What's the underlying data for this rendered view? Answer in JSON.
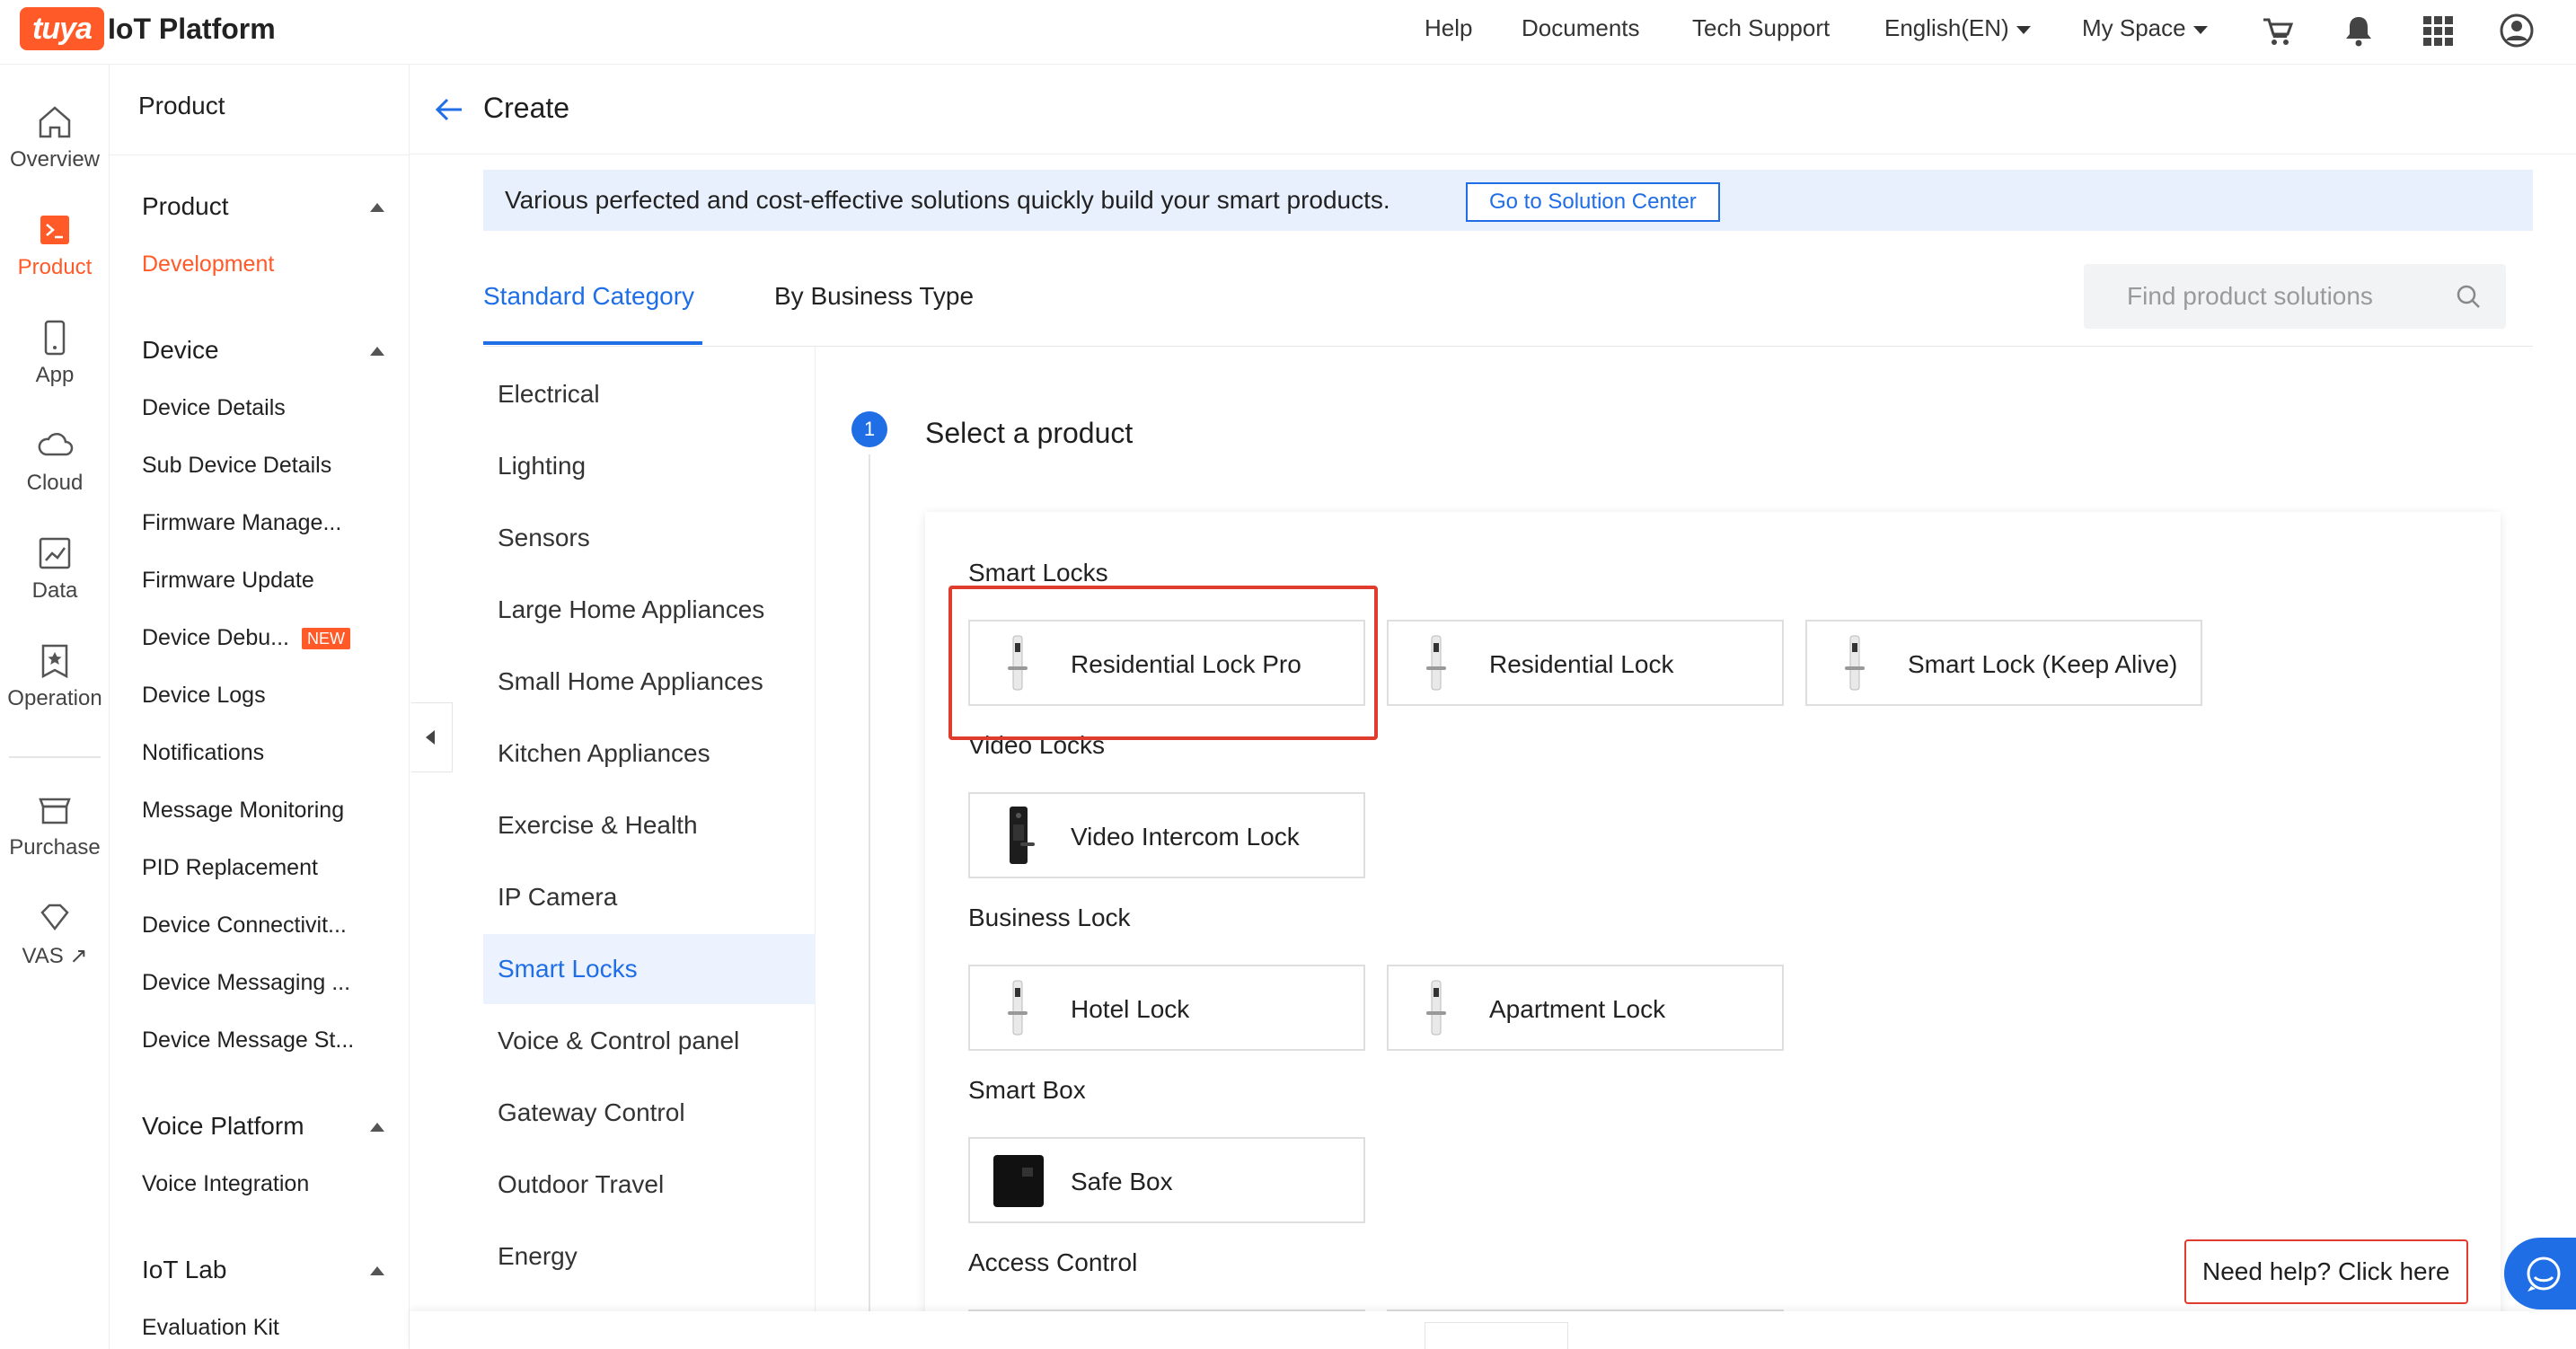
{
  "brand": {
    "logo_text": "tuya",
    "platform": "IoT Platform"
  },
  "topnav": {
    "help": "Help",
    "documents": "Documents",
    "tech_support": "Tech Support",
    "language": "English(EN)",
    "space": "My Space"
  },
  "rail": {
    "overview": "Overview",
    "product": "Product",
    "app": "App",
    "cloud": "Cloud",
    "data": "Data",
    "operation": "Operation",
    "purchase": "Purchase",
    "vas": "VAS"
  },
  "sidebar": {
    "title": "Product",
    "groups": {
      "product": "Product",
      "device": "Device",
      "voice": "Voice Platform",
      "iotlab": "IoT Lab"
    },
    "items": {
      "development": "Development",
      "device_details": "Device Details",
      "sub_device_details": "Sub Device Details",
      "firmware_manage": "Firmware Manage...",
      "firmware_update": "Firmware Update",
      "device_debug": "Device Debu...",
      "new_badge": "NEW",
      "device_logs": "Device Logs",
      "notifications": "Notifications",
      "message_monitoring": "Message Monitoring",
      "pid_replacement": "PID Replacement",
      "device_connectivity": "Device Connectivit...",
      "device_messaging": "Device Messaging ...",
      "device_message_st": "Device Message St...",
      "voice_integration": "Voice Integration",
      "evaluation_kit": "Evaluation Kit"
    }
  },
  "page": {
    "title": "Create"
  },
  "banner": {
    "text": "Various perfected and cost-effective solutions quickly build your smart products.",
    "button": "Go to Solution Center"
  },
  "tabs": {
    "standard": "Standard Category",
    "business": "By Business Type"
  },
  "search": {
    "placeholder": "Find product solutions"
  },
  "categories": [
    "Electrical",
    "Lighting",
    "Sensors",
    "Large Home Appliances",
    "Small Home Appliances",
    "Kitchen Appliances",
    "Exercise & Health",
    "IP Camera",
    "Smart Locks",
    "Voice & Control panel",
    "Gateway Control",
    "Outdoor Travel",
    "Energy"
  ],
  "step": {
    "number": "1",
    "title": "Select a product"
  },
  "sections": {
    "smart_locks": "Smart Locks",
    "video_locks": "Video Locks",
    "business_lock": "Business Lock",
    "smart_box": "Smart Box",
    "access_control": "Access Control"
  },
  "products": {
    "residential_lock_pro": "Residential Lock Pro",
    "residential_lock": "Residential Lock",
    "smart_lock_keep_alive": "Smart Lock (Keep Alive)",
    "video_intercom_lock": "Video Intercom Lock",
    "hotel_lock": "Hotel Lock",
    "apartment_lock": "Apartment Lock",
    "safe_box": "Safe Box"
  },
  "help": {
    "text": "Need help? Click here"
  },
  "colors": {
    "brand": "#ff5a28",
    "accent": "#1f6ee6",
    "highlight": "#e03c2d"
  }
}
